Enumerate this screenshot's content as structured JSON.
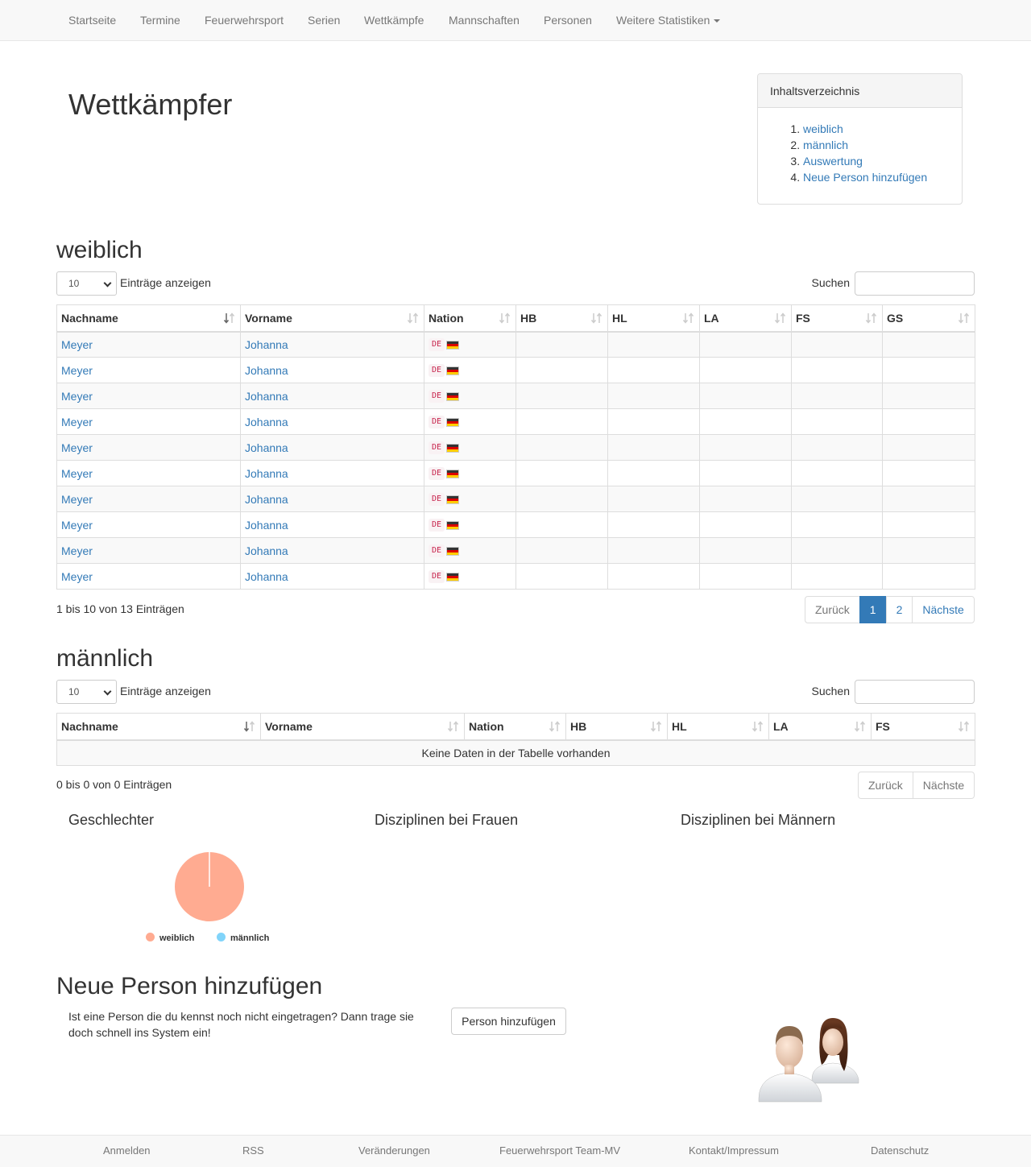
{
  "nav": {
    "items": [
      "Startseite",
      "Termine",
      "Feuerwehrsport",
      "Serien",
      "Wettkämpfe",
      "Mannschaften",
      "Personen",
      "Weitere Statistiken"
    ]
  },
  "page_title": "Wettkämpfer",
  "toc": {
    "heading": "Inhaltsverzeichnis",
    "items": [
      "weiblich",
      "männlich",
      "Auswertung",
      "Neue Person hinzufügen"
    ],
    "numbers": [
      "1.",
      "2.",
      "3.",
      "4."
    ]
  },
  "female": {
    "title": "weiblich",
    "length_value": "10",
    "length_label": "Einträge anzeigen",
    "search_label": "Suchen",
    "columns": [
      "Nachname",
      "Vorname",
      "Nation",
      "HB",
      "HL",
      "LA",
      "FS",
      "GS"
    ],
    "rows": [
      {
        "last": "Meyer",
        "first": "Johanna",
        "nation": "DE",
        "hb": "",
        "hl": "",
        "la": "",
        "fs": "",
        "gs": ""
      },
      {
        "last": "Meyer",
        "first": "Johanna",
        "nation": "DE",
        "hb": "",
        "hl": "",
        "la": "",
        "fs": "",
        "gs": ""
      },
      {
        "last": "Meyer",
        "first": "Johanna",
        "nation": "DE",
        "hb": "",
        "hl": "",
        "la": "",
        "fs": "",
        "gs": ""
      },
      {
        "last": "Meyer",
        "first": "Johanna",
        "nation": "DE",
        "hb": "",
        "hl": "",
        "la": "",
        "fs": "",
        "gs": ""
      },
      {
        "last": "Meyer",
        "first": "Johanna",
        "nation": "DE",
        "hb": "",
        "hl": "",
        "la": "",
        "fs": "",
        "gs": ""
      },
      {
        "last": "Meyer",
        "first": "Johanna",
        "nation": "DE",
        "hb": "",
        "hl": "",
        "la": "",
        "fs": "",
        "gs": ""
      },
      {
        "last": "Meyer",
        "first": "Johanna",
        "nation": "DE",
        "hb": "",
        "hl": "",
        "la": "",
        "fs": "",
        "gs": ""
      },
      {
        "last": "Meyer",
        "first": "Johanna",
        "nation": "DE",
        "hb": "",
        "hl": "",
        "la": "",
        "fs": "",
        "gs": ""
      },
      {
        "last": "Meyer",
        "first": "Johanna",
        "nation": "DE",
        "hb": "",
        "hl": "",
        "la": "",
        "fs": "",
        "gs": ""
      },
      {
        "last": "Meyer",
        "first": "Johanna",
        "nation": "DE",
        "hb": "",
        "hl": "",
        "la": "",
        "fs": "",
        "gs": ""
      }
    ],
    "info": "1 bis 10 von 13 Einträgen",
    "pager": {
      "prev": "Zurück",
      "pages": [
        "1",
        "2"
      ],
      "next": "Nächste"
    }
  },
  "male": {
    "title": "männlich",
    "length_value": "10",
    "length_label": "Einträge anzeigen",
    "search_label": "Suchen",
    "columns": [
      "Nachname",
      "Vorname",
      "Nation",
      "HB",
      "HL",
      "LA",
      "FS"
    ],
    "empty_text": "Keine Daten in der Tabelle vorhanden",
    "info": "0 bis 0 von 0 Einträgen",
    "pager": {
      "prev": "Zurück",
      "next": "Nächste"
    }
  },
  "charts": {
    "titles": [
      "Geschlechter",
      "Disziplinen bei Frauen",
      "Disziplinen bei Männern"
    ],
    "legend": [
      "weiblich",
      "männlich"
    ]
  },
  "chart_data": {
    "type": "pie",
    "title": "Geschlechter",
    "categories": [
      "weiblich",
      "männlich"
    ],
    "values": [
      13,
      0
    ],
    "colors": [
      "#ffab91",
      "#81d4fa"
    ]
  },
  "add_person": {
    "title": "Neue Person hinzufügen",
    "text": "Ist eine Person die du kennst noch nicht eingetragen? Dann trage sie doch schnell ins System ein!",
    "button": "Person hinzufügen"
  },
  "footer": {
    "items": [
      "Anmelden",
      "RSS",
      "Veränderungen",
      "Feuerwehrsport Team-MV",
      "Kontakt/Impressum",
      "Datenschutz"
    ]
  },
  "colors": {
    "link": "#337ab7",
    "active_page": "#337ab7"
  },
  "icons": [
    "sort-icon",
    "sort-asc-icon",
    "caret-down-icon",
    "flag-de-icon",
    "people-icon"
  ]
}
